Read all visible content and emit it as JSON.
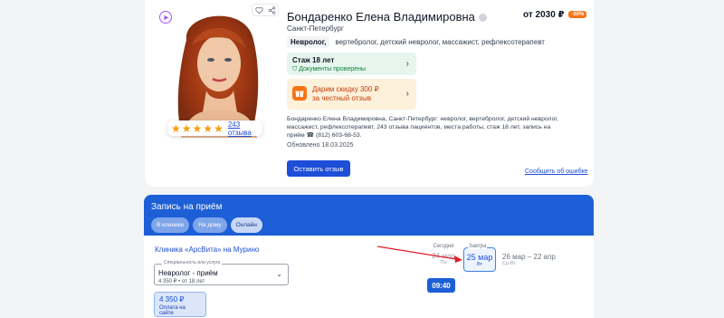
{
  "doctor": {
    "name": "Бондаренко Елена Владимировна",
    "city": "Санкт-Петербург",
    "price": "от 2030 ₽",
    "discount_badge": "-30%",
    "main_specialty": "Невролог,",
    "other_specialties": "вертебролог, детский невролог, массажист, рефлексотерапевт",
    "experience": "Стаж 18 лет",
    "documents": "Документы проверены",
    "promo_line1": "Дарим скидку 300 ₽",
    "promo_line2": "за честный отзыв",
    "description": "Бондаренко Елена Владимировна, Санкт-Петербург: невролог, вертебролог, детский невролог, массажист, рефлексотерапевт, 243 отзыва пациентов, места работы, стаж 18 лет, запись на приём ☎ (812) 603-68-53.",
    "updated": "Обновлено 18.03.2025",
    "reviews_link": "243 отзыва",
    "rating_stars": 5,
    "leave_review_button": "Оставить отзыв",
    "report_error_link": "Сообщить об ошибке"
  },
  "booking": {
    "title": "Запись на приём",
    "tabs": [
      {
        "label": "В клинике"
      },
      {
        "label": "На дому"
      },
      {
        "label": "Онлайн"
      }
    ],
    "active_tab_index": 2,
    "clinic_name": "Клиника «АрсВита» на Мурино",
    "service_select": {
      "legend": "Специальность или услуга",
      "value": "Невролог - приём",
      "sub": "4 350 ₽  •  от 18 лет"
    },
    "price_option": {
      "value": "4 350 ₽",
      "sub": "Оплата на сайте"
    },
    "days": [
      {
        "label": "Сегодня",
        "date": "24 мар",
        "dow": "Пн"
      },
      {
        "label": "Завтра",
        "date": "25 мар",
        "dow": "Вт"
      },
      {
        "label": "",
        "date": "26 мар – 22 апр",
        "dow": "Ср-Вт"
      }
    ],
    "time_slot": "09:40"
  },
  "colors": {
    "brand_blue": "#1d5fd6",
    "promo_orange": "#f97316",
    "verified_green": "#15803d",
    "annotation_arrow": "#e11d2a"
  }
}
